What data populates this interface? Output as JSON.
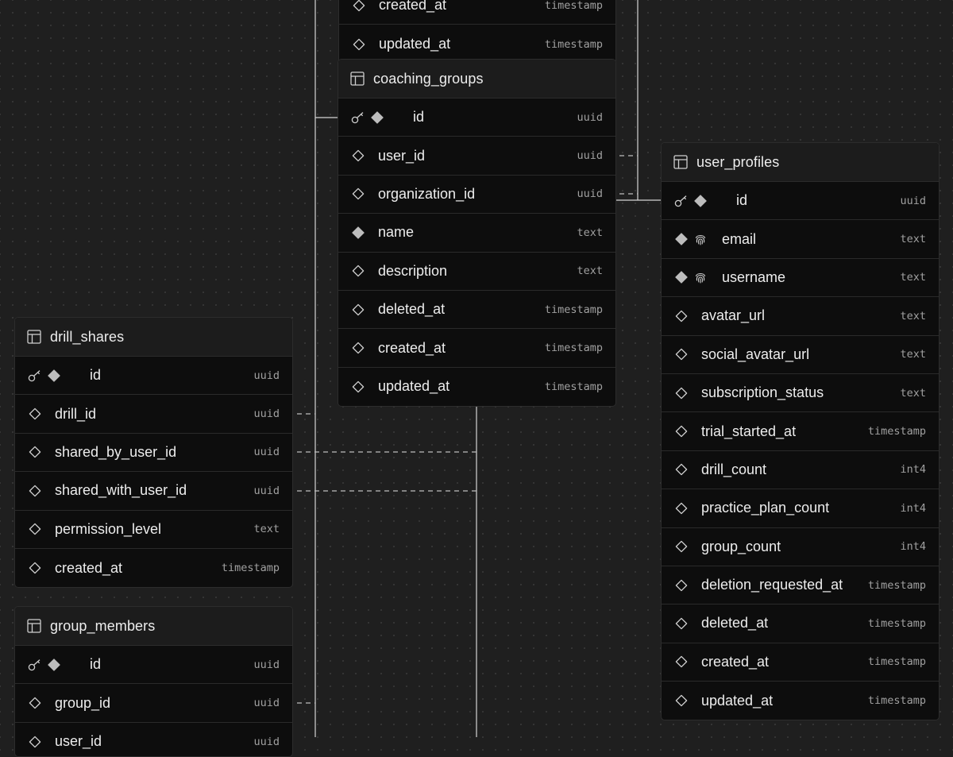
{
  "tables": [
    {
      "id": "top_table",
      "name": "",
      "show_header": false,
      "columns": [
        {
          "name": "created_at",
          "type": "timestamp",
          "kind": "nullable"
        },
        {
          "name": "updated_at",
          "type": "timestamp",
          "kind": "nullable"
        }
      ]
    },
    {
      "id": "coaching_groups",
      "name": "coaching_groups",
      "show_header": true,
      "columns": [
        {
          "name": "id",
          "type": "uuid",
          "kind": "pk"
        },
        {
          "name": "user_id",
          "type": "uuid",
          "kind": "nullable"
        },
        {
          "name": "organization_id",
          "type": "uuid",
          "kind": "nullable"
        },
        {
          "name": "name",
          "type": "text",
          "kind": "required"
        },
        {
          "name": "description",
          "type": "text",
          "kind": "nullable"
        },
        {
          "name": "deleted_at",
          "type": "timestamp",
          "kind": "nullable"
        },
        {
          "name": "created_at",
          "type": "timestamp",
          "kind": "nullable"
        },
        {
          "name": "updated_at",
          "type": "timestamp",
          "kind": "nullable"
        }
      ]
    },
    {
      "id": "user_profiles",
      "name": "user_profiles",
      "show_header": true,
      "columns": [
        {
          "name": "id",
          "type": "uuid",
          "kind": "pk"
        },
        {
          "name": "email",
          "type": "text",
          "kind": "unique"
        },
        {
          "name": "username",
          "type": "text",
          "kind": "unique"
        },
        {
          "name": "avatar_url",
          "type": "text",
          "kind": "nullable"
        },
        {
          "name": "social_avatar_url",
          "type": "text",
          "kind": "nullable"
        },
        {
          "name": "subscription_status",
          "type": "text",
          "kind": "nullable"
        },
        {
          "name": "trial_started_at",
          "type": "timestamp",
          "kind": "nullable"
        },
        {
          "name": "drill_count",
          "type": "int4",
          "kind": "nullable"
        },
        {
          "name": "practice_plan_count",
          "type": "int4",
          "kind": "nullable"
        },
        {
          "name": "group_count",
          "type": "int4",
          "kind": "nullable"
        },
        {
          "name": "deletion_requested_at",
          "type": "timestamp",
          "kind": "nullable"
        },
        {
          "name": "deleted_at",
          "type": "timestamp",
          "kind": "nullable"
        },
        {
          "name": "created_at",
          "type": "timestamp",
          "kind": "nullable"
        },
        {
          "name": "updated_at",
          "type": "timestamp",
          "kind": "nullable"
        }
      ]
    },
    {
      "id": "drill_shares",
      "name": "drill_shares",
      "show_header": true,
      "columns": [
        {
          "name": "id",
          "type": "uuid",
          "kind": "pk"
        },
        {
          "name": "drill_id",
          "type": "uuid",
          "kind": "nullable"
        },
        {
          "name": "shared_by_user_id",
          "type": "uuid",
          "kind": "nullable"
        },
        {
          "name": "shared_with_user_id",
          "type": "uuid",
          "kind": "nullable"
        },
        {
          "name": "permission_level",
          "type": "text",
          "kind": "nullable"
        },
        {
          "name": "created_at",
          "type": "timestamp",
          "kind": "nullable"
        }
      ]
    },
    {
      "id": "group_members",
      "name": "group_members",
      "show_header": true,
      "columns": [
        {
          "name": "id",
          "type": "uuid",
          "kind": "pk"
        },
        {
          "name": "group_id",
          "type": "uuid",
          "kind": "nullable"
        },
        {
          "name": "user_id",
          "type": "uuid",
          "kind": "nullable"
        }
      ]
    }
  ],
  "colors": {
    "background": "#1f1f1f",
    "grid_dot": "#3a3a3a",
    "node_body": "#0d0d0d",
    "node_header": "#1c1c1c",
    "node_border": "#2c2c2c",
    "text": "#ededed",
    "type_text": "#a0a0a0",
    "icon": "#cfcfcf",
    "edge": "#d4d4d4"
  },
  "icons": {
    "table": "table-icon",
    "primary_key": "key-icon",
    "required": "filled-diamond-icon",
    "nullable": "hollow-diamond-icon",
    "unique": "fingerprint-icon"
  }
}
